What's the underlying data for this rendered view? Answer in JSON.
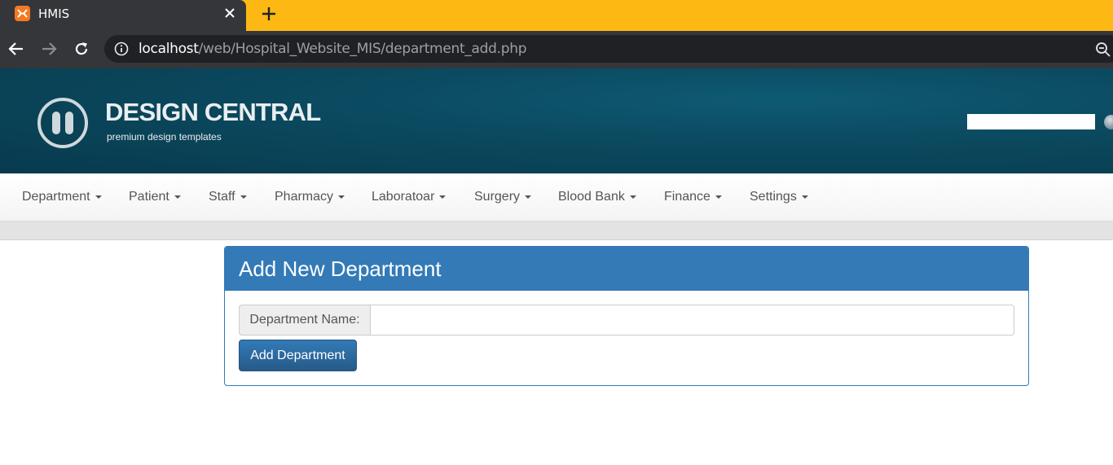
{
  "browser": {
    "tab_title": "HMIS",
    "favicon": "xampp-icon",
    "url_host": "localhost",
    "url_path": "/web/Hospital_Website_MIS/department_add.php",
    "colors": {
      "tabstrip": "#fdb813",
      "chrome": "#35363a",
      "omnibox": "#202124"
    }
  },
  "header": {
    "logo_title": "DESIGN CENTRAL",
    "logo_subtitle": "premium design templates",
    "search_value": "",
    "colors": {
      "background": "#0b4a60"
    }
  },
  "nav": {
    "items": [
      {
        "label": "Department"
      },
      {
        "label": "Patient"
      },
      {
        "label": "Staff"
      },
      {
        "label": "Pharmacy"
      },
      {
        "label": "Laboratoar"
      },
      {
        "label": "Surgery"
      },
      {
        "label": "Blood Bank"
      },
      {
        "label": "Finance"
      },
      {
        "label": "Settings"
      }
    ]
  },
  "form": {
    "title": "Add New Department",
    "field_label": "Department Name:",
    "field_value": "",
    "submit_label": "Add Department",
    "colors": {
      "primary": "#337ab7"
    }
  }
}
